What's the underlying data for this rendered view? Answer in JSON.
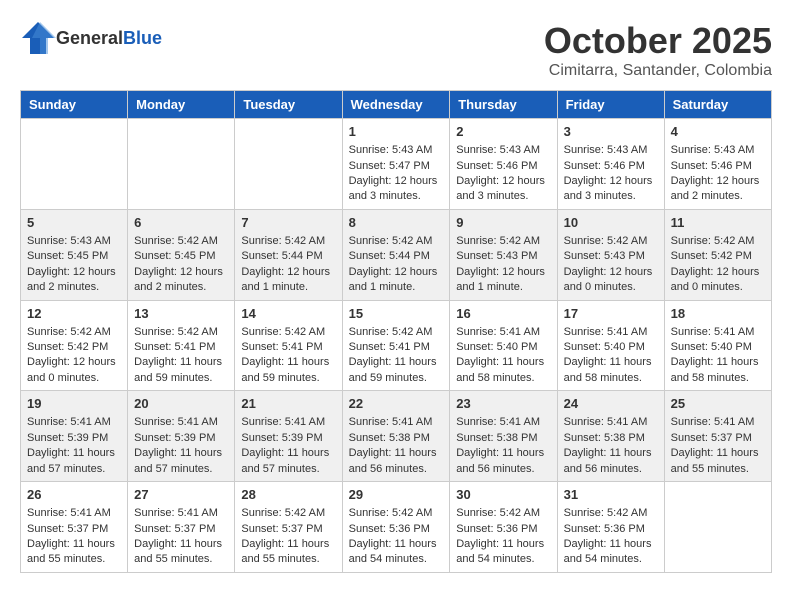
{
  "header": {
    "logo_general": "General",
    "logo_blue": "Blue",
    "month": "October 2025",
    "location": "Cimitarra, Santander, Colombia"
  },
  "weekdays": [
    "Sunday",
    "Monday",
    "Tuesday",
    "Wednesday",
    "Thursday",
    "Friday",
    "Saturday"
  ],
  "weeks": [
    [
      {
        "day": "",
        "sunrise": "",
        "sunset": "",
        "daylight": ""
      },
      {
        "day": "",
        "sunrise": "",
        "sunset": "",
        "daylight": ""
      },
      {
        "day": "",
        "sunrise": "",
        "sunset": "",
        "daylight": ""
      },
      {
        "day": "1",
        "sunrise": "Sunrise: 5:43 AM",
        "sunset": "Sunset: 5:47 PM",
        "daylight": "Daylight: 12 hours and 3 minutes."
      },
      {
        "day": "2",
        "sunrise": "Sunrise: 5:43 AM",
        "sunset": "Sunset: 5:46 PM",
        "daylight": "Daylight: 12 hours and 3 minutes."
      },
      {
        "day": "3",
        "sunrise": "Sunrise: 5:43 AM",
        "sunset": "Sunset: 5:46 PM",
        "daylight": "Daylight: 12 hours and 3 minutes."
      },
      {
        "day": "4",
        "sunrise": "Sunrise: 5:43 AM",
        "sunset": "Sunset: 5:46 PM",
        "daylight": "Daylight: 12 hours and 2 minutes."
      }
    ],
    [
      {
        "day": "5",
        "sunrise": "Sunrise: 5:43 AM",
        "sunset": "Sunset: 5:45 PM",
        "daylight": "Daylight: 12 hours and 2 minutes."
      },
      {
        "day": "6",
        "sunrise": "Sunrise: 5:42 AM",
        "sunset": "Sunset: 5:45 PM",
        "daylight": "Daylight: 12 hours and 2 minutes."
      },
      {
        "day": "7",
        "sunrise": "Sunrise: 5:42 AM",
        "sunset": "Sunset: 5:44 PM",
        "daylight": "Daylight: 12 hours and 1 minute."
      },
      {
        "day": "8",
        "sunrise": "Sunrise: 5:42 AM",
        "sunset": "Sunset: 5:44 PM",
        "daylight": "Daylight: 12 hours and 1 minute."
      },
      {
        "day": "9",
        "sunrise": "Sunrise: 5:42 AM",
        "sunset": "Sunset: 5:43 PM",
        "daylight": "Daylight: 12 hours and 1 minute."
      },
      {
        "day": "10",
        "sunrise": "Sunrise: 5:42 AM",
        "sunset": "Sunset: 5:43 PM",
        "daylight": "Daylight: 12 hours and 0 minutes."
      },
      {
        "day": "11",
        "sunrise": "Sunrise: 5:42 AM",
        "sunset": "Sunset: 5:42 PM",
        "daylight": "Daylight: 12 hours and 0 minutes."
      }
    ],
    [
      {
        "day": "12",
        "sunrise": "Sunrise: 5:42 AM",
        "sunset": "Sunset: 5:42 PM",
        "daylight": "Daylight: 12 hours and 0 minutes."
      },
      {
        "day": "13",
        "sunrise": "Sunrise: 5:42 AM",
        "sunset": "Sunset: 5:41 PM",
        "daylight": "Daylight: 11 hours and 59 minutes."
      },
      {
        "day": "14",
        "sunrise": "Sunrise: 5:42 AM",
        "sunset": "Sunset: 5:41 PM",
        "daylight": "Daylight: 11 hours and 59 minutes."
      },
      {
        "day": "15",
        "sunrise": "Sunrise: 5:42 AM",
        "sunset": "Sunset: 5:41 PM",
        "daylight": "Daylight: 11 hours and 59 minutes."
      },
      {
        "day": "16",
        "sunrise": "Sunrise: 5:41 AM",
        "sunset": "Sunset: 5:40 PM",
        "daylight": "Daylight: 11 hours and 58 minutes."
      },
      {
        "day": "17",
        "sunrise": "Sunrise: 5:41 AM",
        "sunset": "Sunset: 5:40 PM",
        "daylight": "Daylight: 11 hours and 58 minutes."
      },
      {
        "day": "18",
        "sunrise": "Sunrise: 5:41 AM",
        "sunset": "Sunset: 5:40 PM",
        "daylight": "Daylight: 11 hours and 58 minutes."
      }
    ],
    [
      {
        "day": "19",
        "sunrise": "Sunrise: 5:41 AM",
        "sunset": "Sunset: 5:39 PM",
        "daylight": "Daylight: 11 hours and 57 minutes."
      },
      {
        "day": "20",
        "sunrise": "Sunrise: 5:41 AM",
        "sunset": "Sunset: 5:39 PM",
        "daylight": "Daylight: 11 hours and 57 minutes."
      },
      {
        "day": "21",
        "sunrise": "Sunrise: 5:41 AM",
        "sunset": "Sunset: 5:39 PM",
        "daylight": "Daylight: 11 hours and 57 minutes."
      },
      {
        "day": "22",
        "sunrise": "Sunrise: 5:41 AM",
        "sunset": "Sunset: 5:38 PM",
        "daylight": "Daylight: 11 hours and 56 minutes."
      },
      {
        "day": "23",
        "sunrise": "Sunrise: 5:41 AM",
        "sunset": "Sunset: 5:38 PM",
        "daylight": "Daylight: 11 hours and 56 minutes."
      },
      {
        "day": "24",
        "sunrise": "Sunrise: 5:41 AM",
        "sunset": "Sunset: 5:38 PM",
        "daylight": "Daylight: 11 hours and 56 minutes."
      },
      {
        "day": "25",
        "sunrise": "Sunrise: 5:41 AM",
        "sunset": "Sunset: 5:37 PM",
        "daylight": "Daylight: 11 hours and 55 minutes."
      }
    ],
    [
      {
        "day": "26",
        "sunrise": "Sunrise: 5:41 AM",
        "sunset": "Sunset: 5:37 PM",
        "daylight": "Daylight: 11 hours and 55 minutes."
      },
      {
        "day": "27",
        "sunrise": "Sunrise: 5:41 AM",
        "sunset": "Sunset: 5:37 PM",
        "daylight": "Daylight: 11 hours and 55 minutes."
      },
      {
        "day": "28",
        "sunrise": "Sunrise: 5:42 AM",
        "sunset": "Sunset: 5:37 PM",
        "daylight": "Daylight: 11 hours and 55 minutes."
      },
      {
        "day": "29",
        "sunrise": "Sunrise: 5:42 AM",
        "sunset": "Sunset: 5:36 PM",
        "daylight": "Daylight: 11 hours and 54 minutes."
      },
      {
        "day": "30",
        "sunrise": "Sunrise: 5:42 AM",
        "sunset": "Sunset: 5:36 PM",
        "daylight": "Daylight: 11 hours and 54 minutes."
      },
      {
        "day": "31",
        "sunrise": "Sunrise: 5:42 AM",
        "sunset": "Sunset: 5:36 PM",
        "daylight": "Daylight: 11 hours and 54 minutes."
      },
      {
        "day": "",
        "sunrise": "",
        "sunset": "",
        "daylight": ""
      }
    ]
  ]
}
